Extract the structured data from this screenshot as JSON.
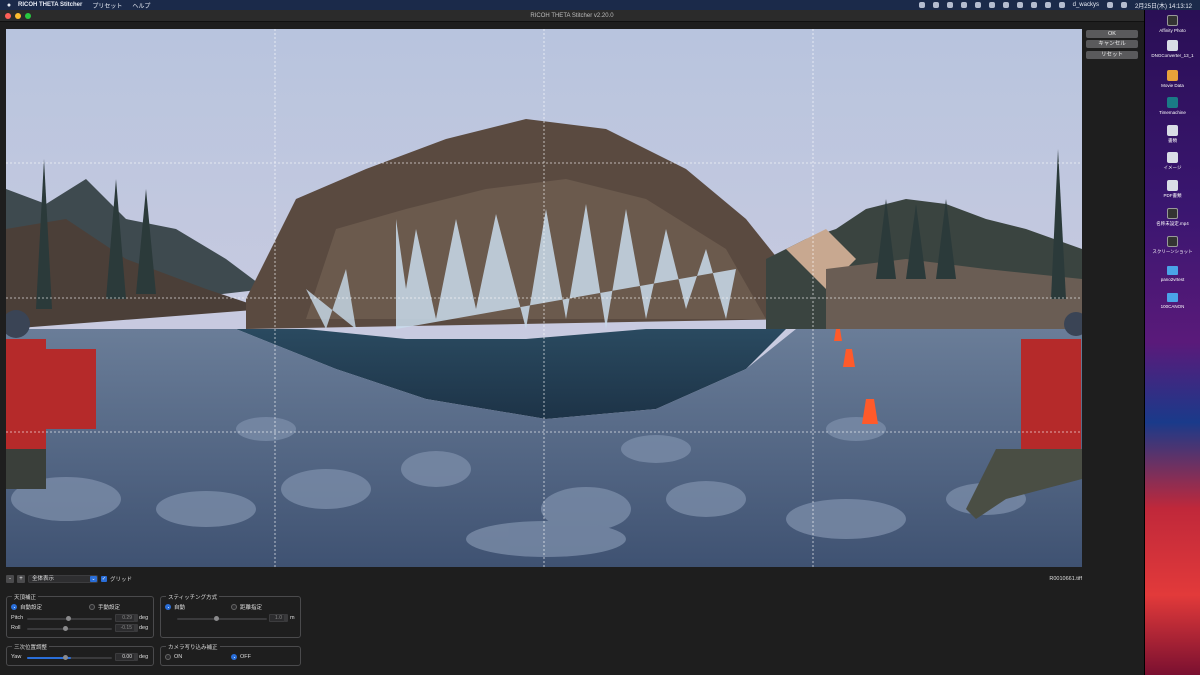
{
  "menubar": {
    "apple": "",
    "app_name": "RICOH THETA Stitcher",
    "menus": [
      "プリセット",
      "ヘルプ"
    ],
    "user": "d_wackys",
    "datetime": "2月25日(木) 14:13:12"
  },
  "window": {
    "title": "RICOH THETA Stitcher v2.20.0"
  },
  "side_buttons": {
    "ok": "OK",
    "cancel": "キャンセル",
    "reset": "リセット"
  },
  "toolbar": {
    "zoom_out": "-",
    "zoom_in": "+",
    "view_mode": "全体表示",
    "grid_label": "グリッド",
    "grid_checked": true,
    "filename": "R0010661.tiff"
  },
  "zenith": {
    "title": "天頂補正",
    "auto_label": "自動設定",
    "manual_label": "手動設定",
    "pitch_label": "Pitch",
    "pitch_value": "0.29",
    "roll_label": "Roll",
    "roll_value": "-0.15",
    "unit": "deg"
  },
  "stitch": {
    "title": "スティッチング方式",
    "auto_label": "自動",
    "distance_label": "距離指定",
    "distance_value": "1.0",
    "unit": "m"
  },
  "threeD": {
    "title": "三次位置調整",
    "yaw_label": "Yaw",
    "yaw_value": "0.00",
    "unit": "deg"
  },
  "camera": {
    "title": "カメラ写り込み補正",
    "on_label": "ON",
    "off_label": "OFF"
  },
  "desktop_icons": [
    {
      "label": "Affinity Photo",
      "icon": "app-icon"
    },
    {
      "label": "DNGConverter_13_1",
      "icon": "disk-icon"
    },
    {
      "label": "Movie Data",
      "icon": "drive-icon"
    },
    {
      "label": "Timemachine",
      "icon": "timemachine-icon"
    },
    {
      "label": "書類",
      "icon": "doc-icon"
    },
    {
      "label": "イメージ",
      "icon": "image-icon"
    },
    {
      "label": "PDF書類",
      "icon": "pdf-icon"
    },
    {
      "label": "名称未設定.mp4",
      "icon": "video-icon"
    },
    {
      "label": "スクリーンショット",
      "icon": "screenshot-icon"
    },
    {
      "label": "pano2vrtest",
      "icon": "folder-icon"
    },
    {
      "label": "100CANON",
      "icon": "folder-icon"
    }
  ],
  "colors": {
    "accent": "#2a6ed8",
    "window_bg": "#1e1e1e",
    "menubar_bg": "#1b2a4a"
  }
}
